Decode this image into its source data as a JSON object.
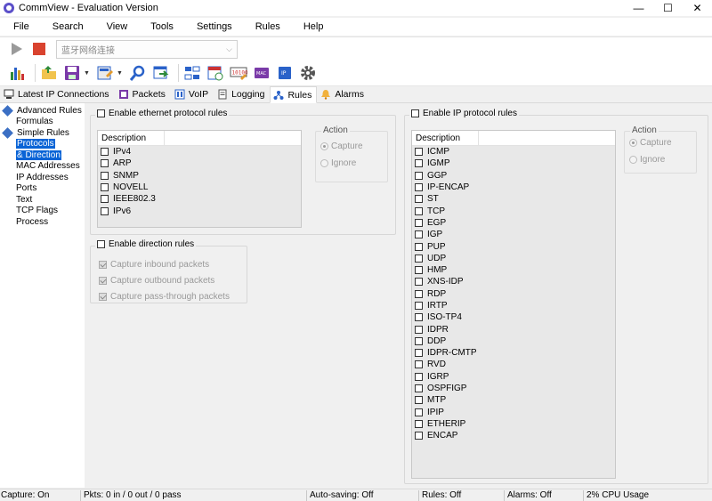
{
  "window": {
    "title": "CommView - Evaluation Version",
    "minimize": "—",
    "maximize": "☐",
    "close": "✕"
  },
  "menu": [
    "File",
    "Search",
    "View",
    "Tools",
    "Settings",
    "Rules",
    "Help"
  ],
  "toolbar": {
    "adapter_value": "蓝牙网络连接"
  },
  "tabs": [
    {
      "label": "Latest IP Connections",
      "icon": "network-icon"
    },
    {
      "label": "Packets",
      "icon": "packets-icon"
    },
    {
      "label": "VoIP",
      "icon": "voip-icon"
    },
    {
      "label": "Logging",
      "icon": "logging-icon"
    },
    {
      "label": "Rules",
      "icon": "rules-icon",
      "active": true
    },
    {
      "label": "Alarms",
      "icon": "alarm-icon"
    }
  ],
  "tree": {
    "advanced": "Advanced Rules",
    "formulas": "Formulas",
    "simple": "Simple Rules",
    "protocols_1": "Protocols",
    "protocols_2": "& Direction",
    "mac": "MAC Addresses",
    "ip": "IP Addresses",
    "ports": "Ports",
    "text": "Text",
    "tcp": "TCP Flags",
    "process": "Process"
  },
  "ethernet": {
    "enable_label": "Enable ethernet protocol rules",
    "column": "Description",
    "items": [
      "IPv4",
      "ARP",
      "SNMP",
      "NOVELL",
      "IEEE802.3",
      "IPv6"
    ],
    "action_title": "Action",
    "capture": "Capture",
    "ignore": "Ignore"
  },
  "direction": {
    "enable_label": "Enable direction rules",
    "inbound": "Capture inbound packets",
    "outbound": "Capture outbound packets",
    "passthrough": "Capture pass-through packets"
  },
  "ip": {
    "enable_label": "Enable IP protocol rules",
    "column": "Description",
    "items": [
      "ICMP",
      "IGMP",
      "GGP",
      "IP-ENCAP",
      "ST",
      "TCP",
      "EGP",
      "IGP",
      "PUP",
      "UDP",
      "HMP",
      "XNS-IDP",
      "RDP",
      "IRTP",
      "ISO-TP4",
      "IDPR",
      "DDP",
      "IDPR-CMTP",
      "RVD",
      "IGRP",
      "OSPFIGP",
      "MTP",
      "IPIP",
      "ETHERIP",
      "ENCAP"
    ],
    "action_title": "Action",
    "capture": "Capture",
    "ignore": "Ignore"
  },
  "status": {
    "capture": "Capture: On",
    "pkts": "Pkts: 0 in / 0 out / 0 pass",
    "autosave": "Auto-saving: Off",
    "rules": "Rules: Off",
    "alarms": "Alarms: Off",
    "cpu": "2% CPU Usage"
  }
}
